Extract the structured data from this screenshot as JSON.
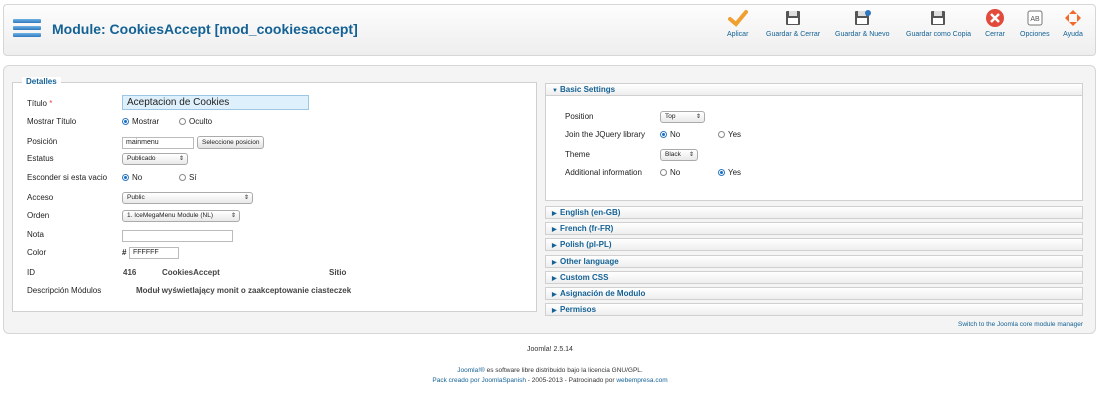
{
  "toolbar": {
    "title": "Module: CookiesAccept [mod_cookiesaccept]",
    "buttons": {
      "apply": "Aplicar",
      "save_close": "Guardar & Cerrar",
      "save_new": "Guardar & Nuevo",
      "save_copy": "Guardar como Copia",
      "close": "Cerrar",
      "options": "Opciones",
      "help": "Ayuda"
    }
  },
  "details": {
    "legend": "Detalles",
    "title_label": "Título",
    "required_mark": "*",
    "title_value": "Aceptacion de Cookies",
    "show_title_label": "Mostrar Título",
    "show_title_options": [
      "Mostrar",
      "Oculto"
    ],
    "position_label": "Posición",
    "position_value": "mainmenu",
    "position_button": "Seleccione posicion",
    "status_label": "Estatus",
    "status_value": "Publicado",
    "hide_empty_label": "Esconder si esta vacio",
    "hide_empty_options": [
      "No",
      "Sí"
    ],
    "access_label": "Acceso",
    "access_value": "Public",
    "order_label": "Orden",
    "order_value": "1. IceMegaMenu Module (NL)",
    "note_label": "Nota",
    "note_value": "",
    "color_label": "Color",
    "color_hash": "#",
    "color_value": "FFFFFF",
    "id_label": "ID",
    "id_value": "416",
    "id_name": "CookiesAccept",
    "id_site": "Sitio",
    "desc_label": "Descripción Módulos",
    "desc_value": "Moduł wyświetlający monit o zaakceptowanie ciasteczek"
  },
  "basic": {
    "header": "Basic Settings",
    "position_label": "Position",
    "position_value": "Top",
    "jquery_label": "Join the JQuery library",
    "jquery_options": [
      "No",
      "Yes"
    ],
    "theme_label": "Theme",
    "theme_value": "Black",
    "additional_label": "Additional information",
    "additional_options": [
      "No",
      "Yes"
    ]
  },
  "panels": [
    "English (en-GB)",
    "French (fr-FR)",
    "Polish (pl-PL)",
    "Other language",
    "Custom CSS",
    "Asignación de Modulo",
    "Permisos"
  ],
  "switch_link": "Switch to the Joomla core module manager",
  "footer": {
    "version": "Joomla! 2.5.14",
    "joomla_link": "Joomla!®",
    "license_text": " es software libre distribuido bajo la",
    "license_link": " licencia GNU/GPL.",
    "pack_prefix": "Pack creado por ",
    "pack_link": "JoomlaSpanish",
    "pack_years": " - 2005-2013 - Patrocinado por ",
    "sponsor_link": "webempresa.com"
  },
  "colors": {
    "brand_blue": "#146295",
    "apply_orange": "#f0a030",
    "close_red": "#e24a3b",
    "help_orange": "#f26a2a"
  }
}
